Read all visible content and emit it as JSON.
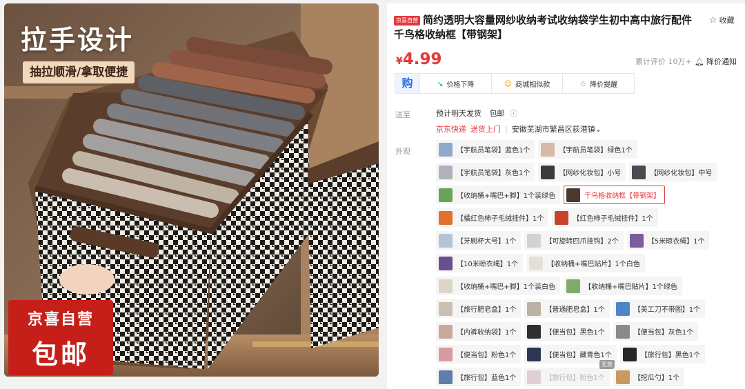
{
  "image": {
    "headline": "拉手设计",
    "sub_caption": "抽拉顺滑/拿取便捷",
    "badge_line1": "京喜自营",
    "badge_line2": "包邮"
  },
  "product": {
    "store_tag": "京喜自营",
    "title": "简约透明大容量网纱收纳考试收纳袋学生初中高中旅行配件千鸟格收纳框【带钢架】",
    "favorite_label": "收藏",
    "price_currency": "¥",
    "price_value": "4.99",
    "reviews": "累计评价 10万+",
    "price_alert": "降价通知"
  },
  "actions": {
    "gou_glyph": "购",
    "items": [
      {
        "label": "价格下降",
        "icon": "trend-down-icon"
      },
      {
        "label": "商城相似款",
        "icon": "smile-icon"
      },
      {
        "label": "降价提醒",
        "icon": "star-icon"
      }
    ]
  },
  "shipping": {
    "label": "送至",
    "line1": "预计明天发货",
    "free": "包邮",
    "carrier": "京东快递",
    "door": "送货上门",
    "address": "安徽芜湖市繁昌区荻港镇",
    "chevron": "⌄"
  },
  "variants": {
    "label": "外观",
    "disabled_tip": "无货",
    "rows": [
      [
        {
          "text": "【宇航员笔袋】蓝色1个",
          "color": "#8fa9c9"
        },
        {
          "text": "【宇航员笔袋】绿色1个",
          "color": "#d7b9a6"
        }
      ],
      [
        {
          "text": "【宇航员笔袋】灰色1个",
          "color": "#aeb3bb"
        },
        {
          "text": "【网纱化妆包】小号",
          "color": "#3b3b3b"
        },
        {
          "text": "【网纱化妆包】中号",
          "color": "#4a4a52"
        }
      ],
      [
        {
          "text": "【收纳桶+嘴巴+脚】1个装绿色",
          "color": "#6aa35a"
        },
        {
          "text": "千鸟格收纳框【带钢架】",
          "color": "#4a3a2e",
          "selected": true
        }
      ],
      [
        {
          "text": "【橘红色柿子毛绒挂件】1个",
          "color": "#e0722c"
        },
        {
          "text": "【红色柿子毛绒挂件】1个",
          "color": "#c9422d"
        }
      ],
      [
        {
          "text": "【牙刷杯大号】1个",
          "color": "#b4c4d6"
        },
        {
          "text": "【可旋转四爪挂钩】2个",
          "color": "#d2d2d2"
        },
        {
          "text": "【5米晾衣绳】1个",
          "color": "#7b5c9c"
        }
      ],
      [
        {
          "text": "【10米晾衣绳】1个",
          "color": "#6a4f8d"
        },
        {
          "text": "【收纳桶+嘴巴贴片】1个白色",
          "color": "#e5e0d6"
        }
      ],
      [
        {
          "text": "【收纳桶+嘴巴+脚】1个装白色",
          "color": "#ddd6c8"
        },
        {
          "text": "【收纳桶+嘴巴贴片】1个绿色",
          "color": "#7faa6a"
        }
      ],
      [
        {
          "text": "【旅行肥皂盒】1个",
          "color": "#c9c0b1"
        },
        {
          "text": "【普通肥皂盒】1个",
          "color": "#b9b2a5"
        },
        {
          "text": "【美工刀不带图】1个",
          "color": "#4d86c6"
        }
      ],
      [
        {
          "text": "【内裤收纳袋】1个",
          "color": "#c8a89a"
        },
        {
          "text": "【便当包】黑色1个",
          "color": "#2f2f2f"
        },
        {
          "text": "【便当包】灰色1个",
          "color": "#8a8a8a"
        }
      ],
      [
        {
          "text": "【便当包】粉色1个",
          "color": "#d79aa4"
        },
        {
          "text": "【便当包】藏青色1个",
          "color": "#2c3853"
        },
        {
          "text": "【旅行包】黑色1个",
          "color": "#262626"
        }
      ],
      [
        {
          "text": "【旅行包】蓝色1个",
          "color": "#5f7fa8"
        },
        {
          "text": "【旅行包】粉色1个",
          "color": "#c6a0a8",
          "disabled": true
        },
        {
          "text": "【挖瓜勺】1个",
          "color": "#c89a62"
        }
      ]
    ]
  },
  "colors": {
    "accent_red": "#e4393c",
    "badge_red": "#c61f1a"
  }
}
